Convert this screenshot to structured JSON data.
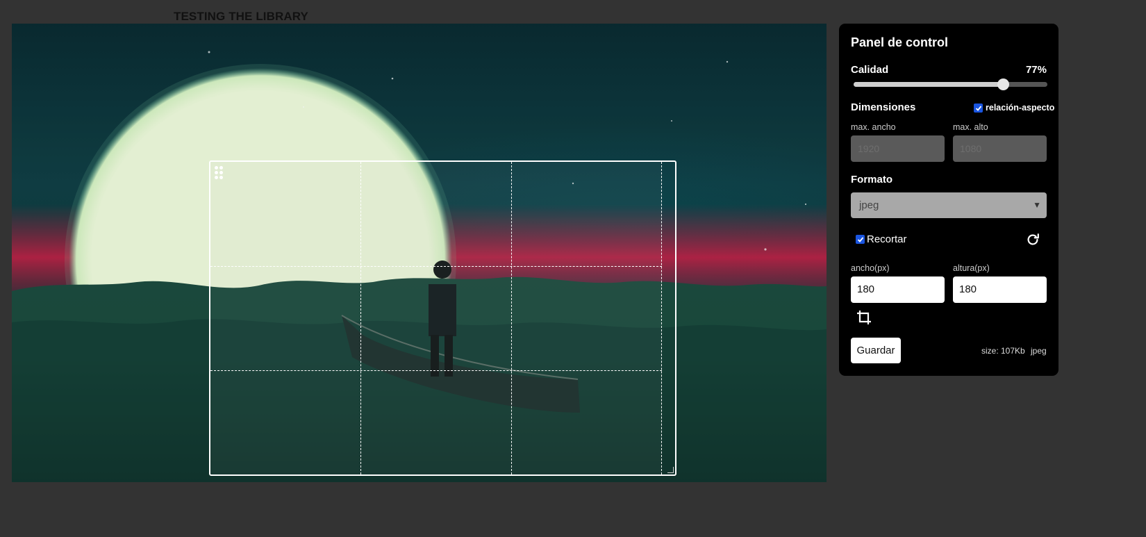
{
  "page": {
    "heading": "TESTING THE LIBRARY"
  },
  "panel": {
    "title": "Panel de control",
    "quality": {
      "label": "Calidad",
      "value_text": "77%",
      "value": 0.77
    },
    "dimensions": {
      "label": "Dimensiones",
      "aspect_ratio_label": "relación-aspecto",
      "aspect_ratio_checked": true,
      "max_width_label": "max. ancho",
      "max_width_placeholder": "1920",
      "max_height_label": "max. alto",
      "max_height_placeholder": "1080"
    },
    "format": {
      "label": "Formato",
      "selected": "jpeg"
    },
    "crop": {
      "label": "Recortar",
      "checked": true,
      "width_label": "ancho(px)",
      "width_value": "180",
      "height_label": "altura(px)",
      "height_value": "180"
    },
    "save_label": "Guardar",
    "size_text": "size: 107Kb",
    "format_text": "jpeg"
  },
  "colors": {
    "page_bg": "#333333",
    "panel_bg": "#000000",
    "checkbox_accent": "#1a55e0"
  },
  "icons": {
    "refresh": "refresh-icon",
    "crop": "crop-icon",
    "drag": "drag-handle-icon",
    "resize": "resize-handle-icon"
  }
}
